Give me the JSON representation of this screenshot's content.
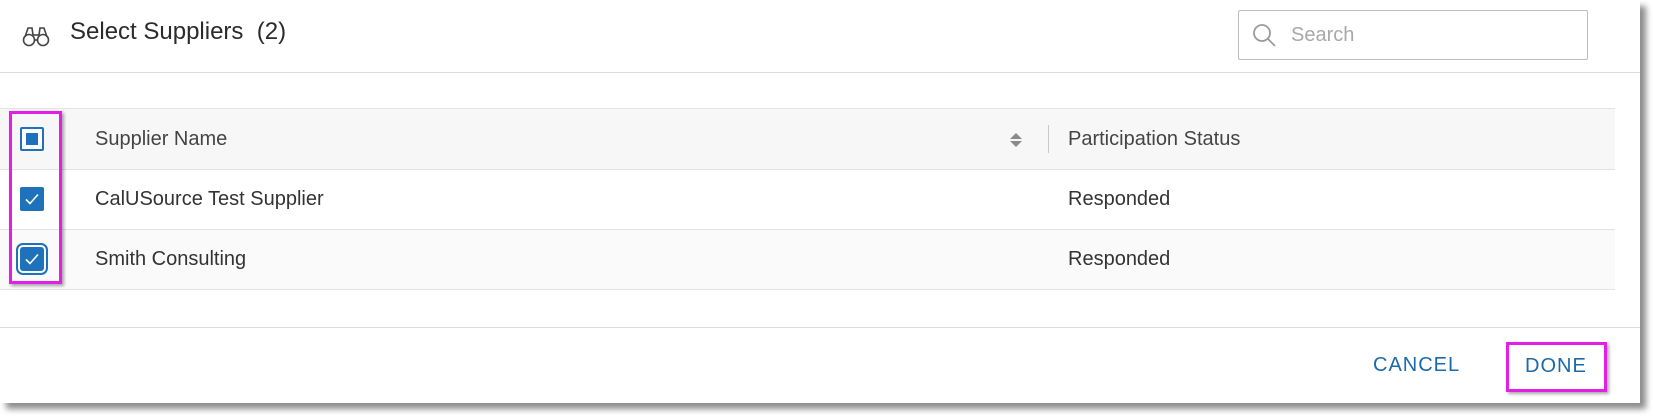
{
  "header": {
    "icon": "binoculars-icon",
    "title": "Select Suppliers",
    "count": "(2)"
  },
  "search": {
    "placeholder": "Search",
    "value": ""
  },
  "table": {
    "columns": [
      "Supplier Name",
      "Participation Status"
    ],
    "rows": [
      {
        "name": "CalUSource Test Supplier",
        "status": "Responded",
        "checked": true
      },
      {
        "name": "Smith Consulting",
        "status": "Responded",
        "checked": true
      }
    ],
    "select_all_state": "indeterminate"
  },
  "footer": {
    "cancel_label": "CANCEL",
    "done_label": "DONE"
  },
  "colors": {
    "accent": "#1d72bb",
    "button_text": "#1b6aa9",
    "highlight": "#e31ee6"
  }
}
